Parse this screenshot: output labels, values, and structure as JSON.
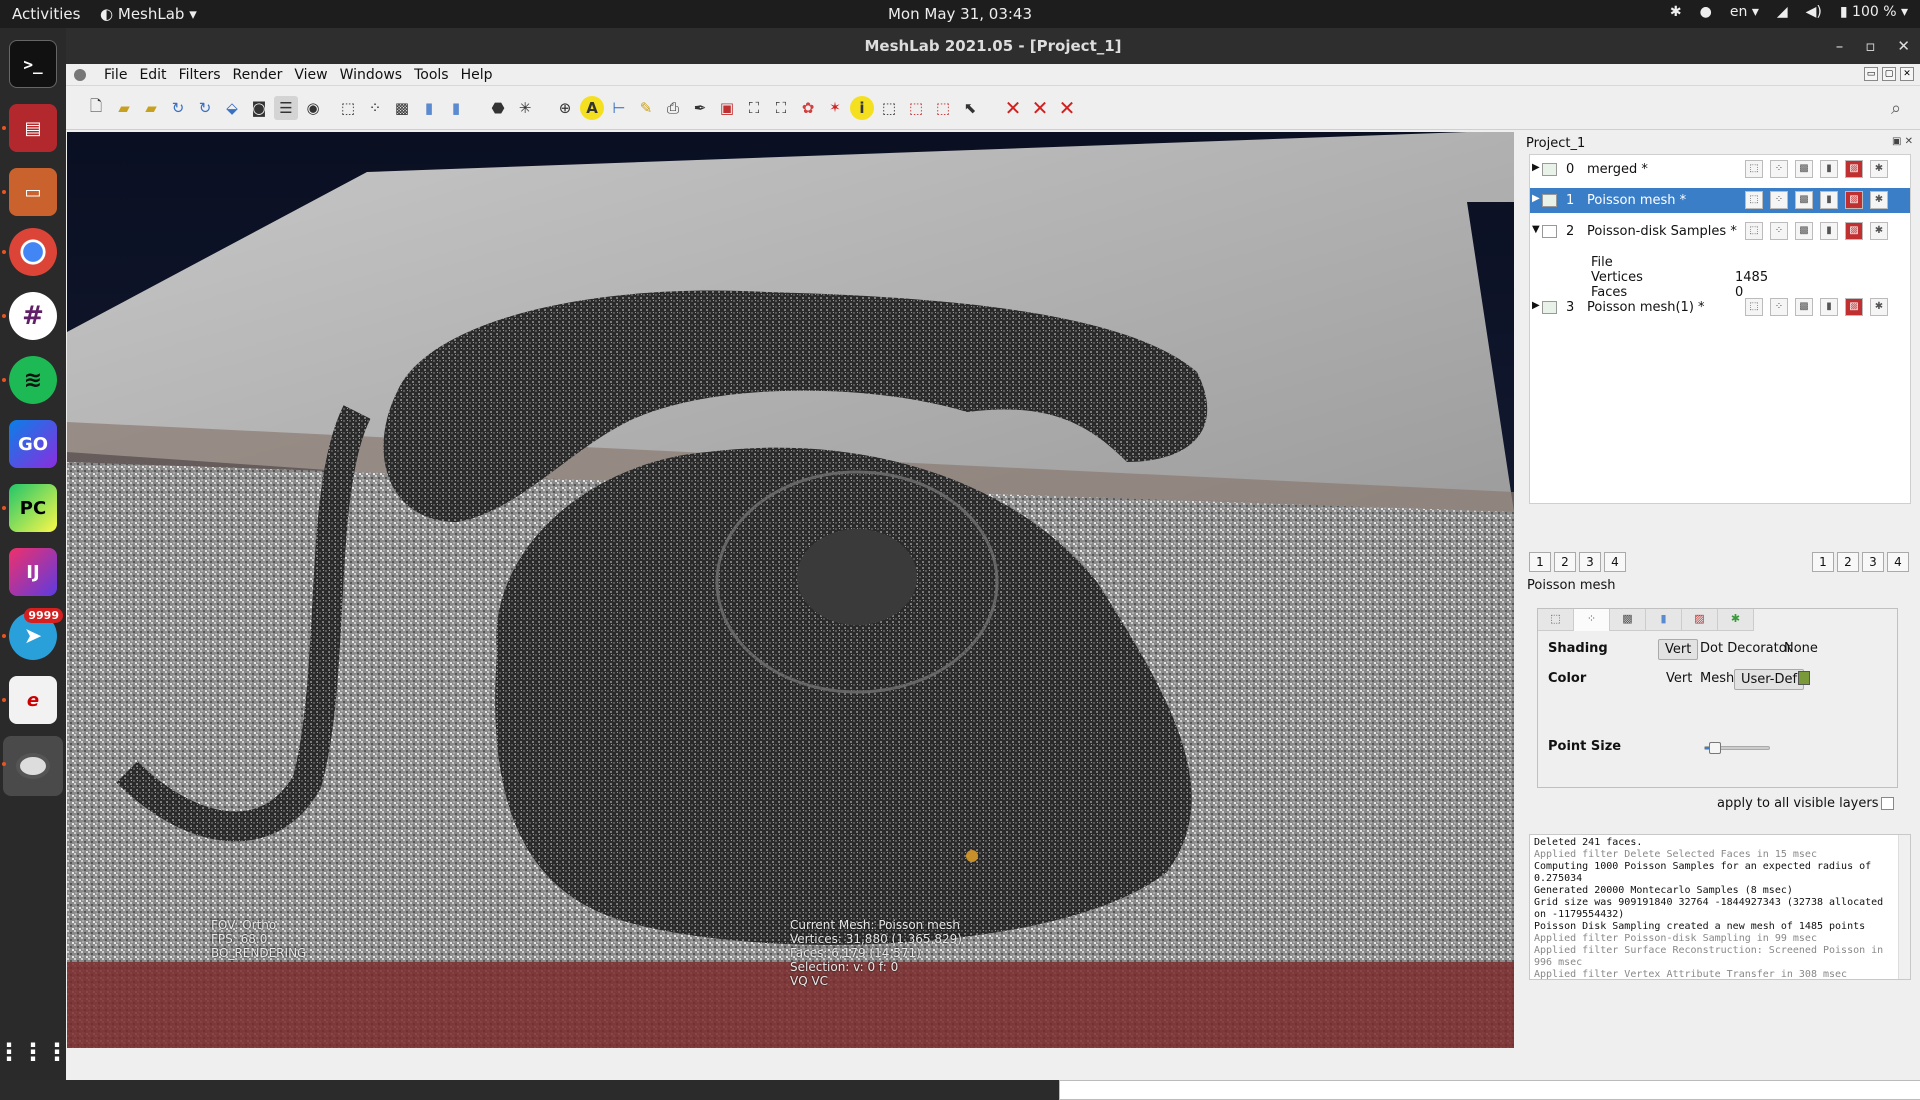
{
  "topbar": {
    "activities": "Activities",
    "app_name": "MeshLab",
    "clock": "Mon May 31, 03:43",
    "keyboard": "en",
    "battery": "100 %"
  },
  "dock": {
    "items": [
      "terminal-icon",
      "app-icon",
      "files-icon",
      "chrome-icon",
      "slack-icon",
      "spotify-icon",
      "goland-icon",
      "pycharm-icon",
      "intellij-icon",
      "telegram-icon",
      "app-icon",
      "meshlab-icon",
      "show-apps-icon"
    ],
    "telegram_badge": "9999",
    "goland_label": "GO",
    "pycharm_label": "PC",
    "intellij_label": "IJ"
  },
  "window": {
    "title": "MeshLab 2021.05 - [Project_1]"
  },
  "menu": {
    "items": [
      "File",
      "Edit",
      "Filters",
      "Render",
      "View",
      "Windows",
      "Tools",
      "Help"
    ]
  },
  "viewport": {
    "fov": "FOV: Ortho",
    "fps": "FPS:   68.0",
    "rendering": "BO_RENDERING",
    "current_mesh": "Current Mesh: Poisson mesh",
    "vertices": "Vertices: 31,880    (1,365,829)",
    "faces": "Faces: 6,179    (14,571)",
    "selection": "Selection: v: 0 f: 0",
    "vq": "VQ VC"
  },
  "panel": {
    "title": "Project_1",
    "layers": [
      {
        "index": "0",
        "name": "merged *"
      },
      {
        "index": "1",
        "name": "Poisson mesh *"
      },
      {
        "index": "2",
        "name": "Poisson-disk Samples *"
      },
      {
        "index": "3",
        "name": "Poisson mesh(1) *"
      }
    ],
    "details": {
      "file_label": "File",
      "vertices_label": "Vertices",
      "vertices_value": "1485",
      "faces_label": "Faces",
      "faces_value": "0"
    },
    "left_nums": [
      "1",
      "2",
      "3",
      "4"
    ],
    "right_nums": [
      "1",
      "2",
      "3",
      "4"
    ],
    "selected_mesh": "Poisson mesh",
    "decorator": {
      "shading_label": "Shading",
      "shading_options": [
        "Vert",
        "Dot Decorator",
        "None"
      ],
      "color_label": "Color",
      "color_options": [
        "Vert",
        "Mesh",
        "User-Def"
      ],
      "user_color": "#7a9a3a",
      "point_size_label": "Point Size",
      "point_size_level": 0.15
    },
    "apply_all_label": "apply to all visible layers"
  },
  "log": [
    {
      "text": "Deleted 241 faces.",
      "dim": false
    },
    {
      "text": "Applied filter Delete Selected Faces in 15 msec",
      "dim": true
    },
    {
      "text": "Computing 1000 Poisson Samples for an expected radius of 0.275034",
      "dim": false
    },
    {
      "text": "Generated 20000 Montecarlo Samples (8 msec)",
      "dim": false
    },
    {
      "text": "Grid size was 909191840 32764 -1844927343 (32738 allocated on -1179554432)",
      "dim": false
    },
    {
      "text": "Poisson Disk Sampling created a new mesh of 1485 points",
      "dim": false
    },
    {
      "text": "Applied filter Poisson-disk Sampling in 99 msec",
      "dim": true
    },
    {
      "text": "Applied filter Surface Reconstruction: Screened Poisson in 996 msec",
      "dim": true
    },
    {
      "text": "Applied filter Vertex Attribute Transfer in 308 msec",
      "dim": true
    }
  ]
}
